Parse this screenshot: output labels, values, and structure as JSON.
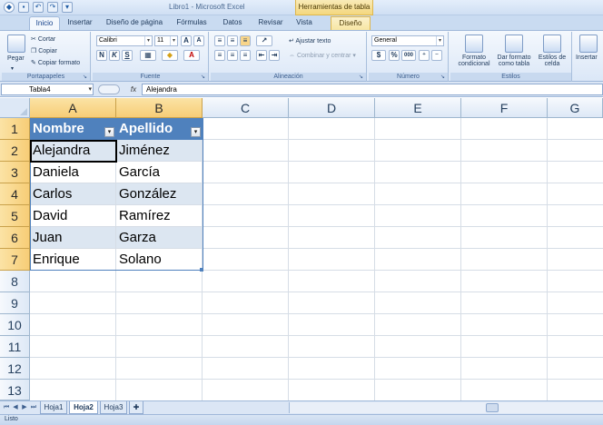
{
  "window": {
    "title": "Libro1 - Microsoft Excel",
    "context_header": "Herramientas de tabla"
  },
  "ribbon_tabs": [
    "Inicio",
    "Insertar",
    "Diseño de página",
    "Fórmulas",
    "Datos",
    "Revisar",
    "Vista",
    "Diseño"
  ],
  "active_tab": "Inicio",
  "clipboard": {
    "paste": "Pegar",
    "cut": "Cortar",
    "copy": "Copiar",
    "format_painter": "Copiar formato",
    "label": "Portapapeles"
  },
  "font": {
    "name": "Calibri",
    "size": "11",
    "bold": "N",
    "italic": "K",
    "underline": "S",
    "label": "Fuente"
  },
  "alignment": {
    "wrap": "Ajustar texto",
    "merge": "Combinar y centrar",
    "label": "Alineación"
  },
  "number": {
    "format": "General",
    "currency": "$",
    "percent": "%",
    "thousands": "000",
    "label": "Número"
  },
  "styles": {
    "conditional_1": "Formato",
    "conditional_2": "condicional",
    "as_table_1": "Dar formato",
    "as_table_2": "como tabla",
    "cell_styles_1": "Estilos de",
    "cell_styles_2": "celda",
    "label": "Estilos"
  },
  "cells_group": {
    "insert": "Insertar"
  },
  "formula_bar": {
    "name_box": "Tabla4",
    "fx": "fx",
    "content": "Alejandra"
  },
  "columns": [
    "A",
    "B",
    "C",
    "D",
    "E",
    "F",
    "G"
  ],
  "rows": [
    "1",
    "2",
    "3",
    "4",
    "5",
    "6",
    "7",
    "8",
    "9",
    "10",
    "11",
    "12",
    "13"
  ],
  "table": {
    "headers": [
      "Nombre",
      "Apellido"
    ],
    "rows": [
      [
        "Alejandra",
        "Jiménez"
      ],
      [
        "Daniela",
        "García"
      ],
      [
        "Carlos",
        "González"
      ],
      [
        "David",
        "Ramírez"
      ],
      [
        "Juan",
        "Garza"
      ],
      [
        "Enrique",
        "Solano"
      ]
    ],
    "header_color": "#4F81BD",
    "band_color": "#DCE6F1"
  },
  "sheets": [
    "Hoja1",
    "Hoja2",
    "Hoja3"
  ],
  "active_sheet": "Hoja2",
  "status": "Listo"
}
